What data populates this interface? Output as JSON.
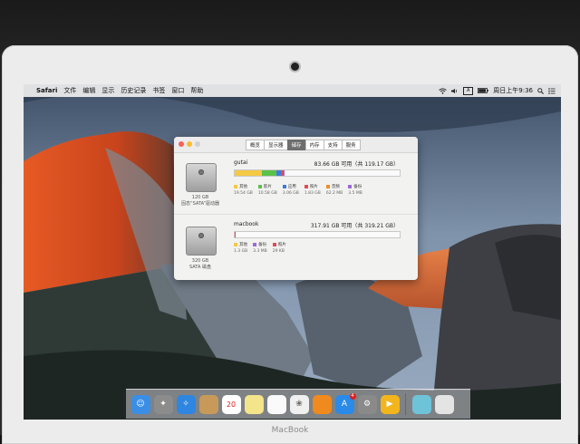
{
  "menubar": {
    "apple_glyph": "",
    "items": [
      "Safari",
      "文件",
      "编辑",
      "显示",
      "历史记录",
      "书签",
      "窗口",
      "帮助"
    ],
    "input_indicator": "A",
    "clock": "周日上午9:36"
  },
  "window": {
    "tabs": [
      "概览",
      "显示器",
      "储存",
      "内存",
      "支持",
      "服务"
    ],
    "active_tab": "储存",
    "disks": [
      {
        "name": "gutai",
        "available": "83.66 GB 可用（共 119.17 GB）",
        "size": "120 GB",
        "type": "固态“SATA”驱动器",
        "fill_fraction": 0.3,
        "segments": [
          {
            "label": "其他",
            "amount": "19.54 GB",
            "color": "#f5c945",
            "share": 0.55
          },
          {
            "label": "影片",
            "amount": "10.58 GB",
            "color": "#5cc14a",
            "share": 0.3
          },
          {
            "label": "应用",
            "amount": "3.06 GB",
            "color": "#3d7be0",
            "share": 0.086
          },
          {
            "label": "照片",
            "amount": "1.83 GB",
            "color": "#e24b55",
            "share": 0.051
          },
          {
            "label": "音频",
            "amount": "62.2 MB",
            "color": "#f08c2a",
            "share": 0.007
          },
          {
            "label": "备份",
            "amount": "3.5 MB",
            "color": "#9a6ad6",
            "share": 0.006
          }
        ]
      },
      {
        "name": "macbook",
        "available": "317.91 GB 可用（共 319.21 GB）",
        "size": "320 GB",
        "type": "SATA 磁盘",
        "fill_fraction": 0.004,
        "segments": [
          {
            "label": "其他",
            "amount": "1.3 GB",
            "color": "#f5c945",
            "share": 0.1
          },
          {
            "label": "备份",
            "amount": "3.3 MB",
            "color": "#9a6ad6",
            "share": 0.1
          },
          {
            "label": "照片",
            "amount": "29 KB",
            "color": "#e24b55",
            "share": 0.8
          }
        ]
      }
    ]
  },
  "dock": {
    "apps": [
      {
        "name": "finder",
        "glyph": "☺",
        "color": "#3a8ee6"
      },
      {
        "name": "launchpad",
        "glyph": "✦",
        "color": "#8c8c8c"
      },
      {
        "name": "safari",
        "glyph": "✧",
        "color": "#2f86e0"
      },
      {
        "name": "contacts",
        "glyph": "",
        "color": "#c79a5a"
      },
      {
        "name": "calendar",
        "glyph": "20",
        "color": "#ffffff"
      },
      {
        "name": "notes",
        "glyph": "",
        "color": "#f4e58a"
      },
      {
        "name": "reminders",
        "glyph": "",
        "color": "#fafafa"
      },
      {
        "name": "photos",
        "glyph": "❀",
        "color": "#f0f0f0"
      },
      {
        "name": "ibooks",
        "glyph": "",
        "color": "#f08a1e"
      },
      {
        "name": "app-store",
        "glyph": "A",
        "color": "#2a8ae8",
        "badge": "4"
      },
      {
        "name": "system-preferences",
        "glyph": "⚙",
        "color": "#8a8a8a"
      },
      {
        "name": "infuse",
        "glyph": "▶",
        "color": "#f3b51d"
      },
      {
        "name": "folder",
        "glyph": "",
        "color": "#6fc3d8"
      },
      {
        "name": "trash",
        "glyph": "",
        "color": "#e4e4e4"
      }
    ]
  },
  "bezel_label": "MacBook"
}
